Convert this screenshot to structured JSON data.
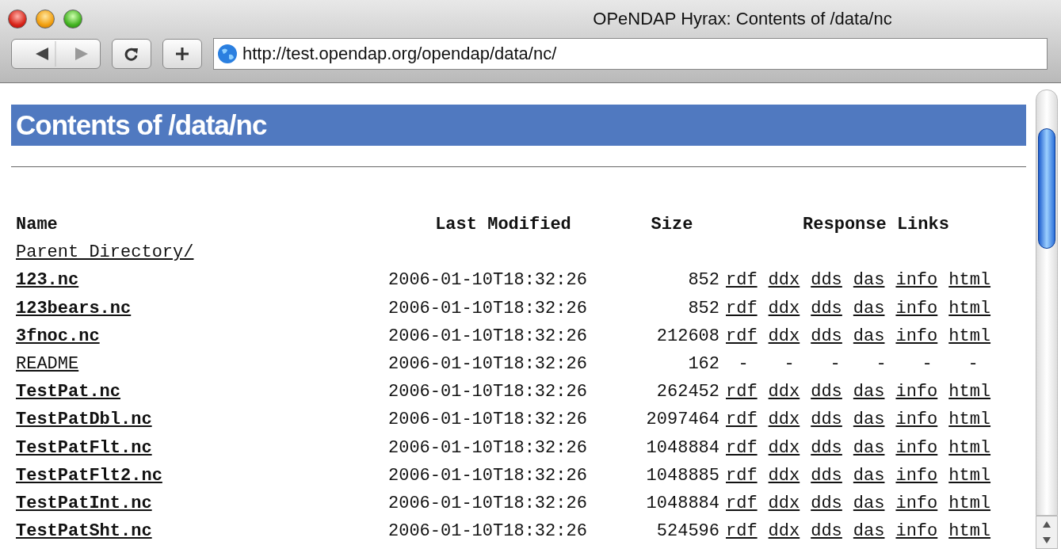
{
  "window": {
    "title": "OPeNDAP Hyrax: Contents of /data/nc"
  },
  "toolbar": {
    "address": "http://test.opendap.org/opendap/data/nc/"
  },
  "page": {
    "heading": "Contents of /data/nc",
    "columns": [
      "Name",
      "Last Modified",
      "Size",
      "Response Links"
    ],
    "rows": [
      {
        "kind": "parent",
        "name": "Parent Directory/"
      },
      {
        "kind": "dataset",
        "name": "123.nc",
        "modified": "2006-01-10T18:32:26",
        "size": "852",
        "links": [
          "rdf",
          "ddx",
          "dds",
          "das",
          "info",
          "html"
        ]
      },
      {
        "kind": "dataset",
        "name": "123bears.nc",
        "modified": "2006-01-10T18:32:26",
        "size": "852",
        "links": [
          "rdf",
          "ddx",
          "dds",
          "das",
          "info",
          "html"
        ]
      },
      {
        "kind": "dataset",
        "name": "3fnoc.nc",
        "modified": "2006-01-10T18:32:26",
        "size": "212608",
        "links": [
          "rdf",
          "ddx",
          "dds",
          "das",
          "info",
          "html"
        ]
      },
      {
        "kind": "file",
        "name": "README",
        "modified": "2006-01-10T18:32:26",
        "size": "162",
        "links": [
          "-",
          "-",
          "-",
          "-",
          "-",
          "-"
        ]
      },
      {
        "kind": "dataset",
        "name": "TestPat.nc",
        "modified": "2006-01-10T18:32:26",
        "size": "262452",
        "links": [
          "rdf",
          "ddx",
          "dds",
          "das",
          "info",
          "html"
        ]
      },
      {
        "kind": "dataset",
        "name": "TestPatDbl.nc",
        "modified": "2006-01-10T18:32:26",
        "size": "2097464",
        "links": [
          "rdf",
          "ddx",
          "dds",
          "das",
          "info",
          "html"
        ]
      },
      {
        "kind": "dataset",
        "name": "TestPatFlt.nc",
        "modified": "2006-01-10T18:32:26",
        "size": "1048884",
        "links": [
          "rdf",
          "ddx",
          "dds",
          "das",
          "info",
          "html"
        ]
      },
      {
        "kind": "dataset",
        "name": "TestPatFlt2.nc",
        "modified": "2006-01-10T18:32:26",
        "size": "1048885",
        "links": [
          "rdf",
          "ddx",
          "dds",
          "das",
          "info",
          "html"
        ]
      },
      {
        "kind": "dataset",
        "name": "TestPatInt.nc",
        "modified": "2006-01-10T18:32:26",
        "size": "1048884",
        "links": [
          "rdf",
          "ddx",
          "dds",
          "das",
          "info",
          "html"
        ]
      },
      {
        "kind": "dataset",
        "name": "TestPatSht.nc",
        "modified": "2006-01-10T18:32:26",
        "size": "524596",
        "links": [
          "rdf",
          "ddx",
          "dds",
          "das",
          "info",
          "html"
        ]
      }
    ]
  }
}
